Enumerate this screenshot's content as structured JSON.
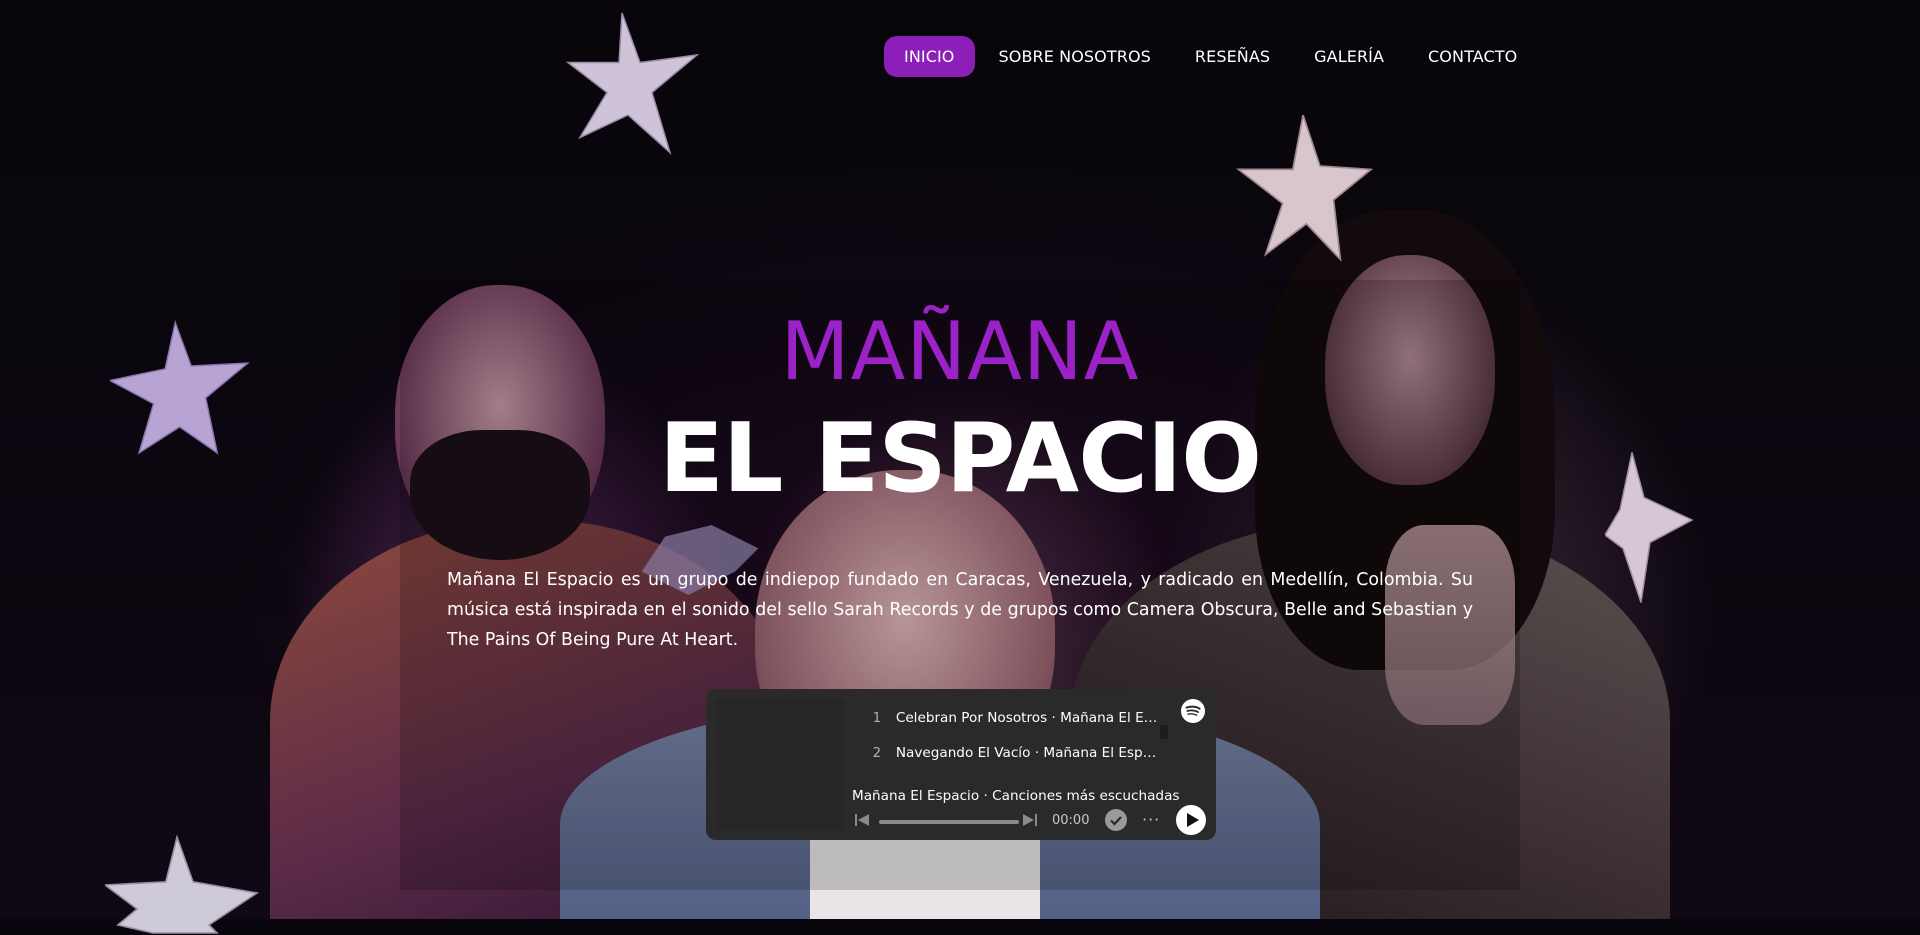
{
  "nav": {
    "items": [
      {
        "label": "INICIO",
        "active": true
      },
      {
        "label": "SOBRE NOSOTROS",
        "active": false
      },
      {
        "label": "RESEÑAS",
        "active": false
      },
      {
        "label": "GALERÍA",
        "active": false
      },
      {
        "label": "CONTACTO",
        "active": false
      }
    ]
  },
  "hero": {
    "title_top": "MAÑANA",
    "title_bottom": "EL ESPACIO",
    "description": "Mañana El Espacio es un grupo de indiepop fundado en Caracas, Venezuela, y radicado en Medellín, Colombia. Su música está inspirada en el sonido del sello Sarah Records y de grupos como Camera Obscura, Belle and Sebastian y The Pains Of Being Pure At Heart."
  },
  "spotify": {
    "tracks": [
      {
        "num": "1",
        "title": "Celebran Por Nosotros · Mañana El Espacio"
      },
      {
        "num": "2",
        "title": "Navegando El Vacío · Mañana El Espacio"
      }
    ],
    "playlist_title": "Mañana El Espacio · Canciones más escuchadas",
    "time": "00:00",
    "more_glyph": "···",
    "icons": {
      "logo": "spotify-icon",
      "prev": "skip-back-icon",
      "next": "skip-forward-icon",
      "saved": "check-circle-icon",
      "more": "more-icon",
      "play": "play-icon"
    }
  },
  "colors": {
    "accent": "#8c1fb8",
    "title_purple": "#9a22c6",
    "background": "#08060c",
    "player_bg": "#2a2a2a"
  }
}
